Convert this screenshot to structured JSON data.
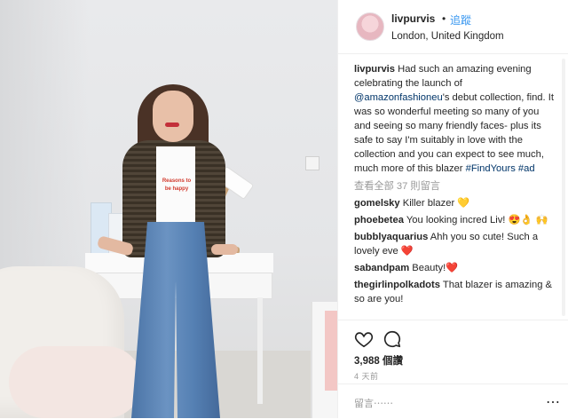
{
  "post": {
    "username": "livpurvis",
    "separator": "•",
    "follow_label": "追蹤",
    "location": "London, United Kingdom",
    "shirt_text": "Reasons to be happy"
  },
  "caption": {
    "username": "livpurvis",
    "part1": " Had such an amazing evening celebrating the launch of ",
    "mention": "@amazonfashioneu",
    "part2": "'s debut collection, find. It was so wonderful meeting so many of you and seeing so many friendly faces- plus its safe to say I'm suitably in love with the collection and you can expect to see much, much more of this blazer ",
    "tag1": "#FindYours",
    "space": " ",
    "tag2": "#ad"
  },
  "view_all": "查看全部 37 則留言",
  "comments": [
    {
      "user": "gomelsky",
      "text": " Killer blazer 💛"
    },
    {
      "user": "phoebetea",
      "text": " You looking incred Liv! 😍👌 🙌"
    },
    {
      "user": "bubblyaquarius",
      "text": " Ahh you so cute! Such a lovely eve ❤️"
    },
    {
      "user": "sabandpam",
      "text": " Beauty!❤️"
    },
    {
      "user": "thegirlinpolkadots",
      "text": " That blazer is amazing & so are you!"
    }
  ],
  "likes": "3,988 個讚",
  "time": "4 天前",
  "comment_placeholder": "留言⋯⋯",
  "more_label": "⋯",
  "icons": {
    "like": "heart-icon",
    "comment": "comment-icon",
    "more": "more-options-icon"
  },
  "colors": {
    "link": "#003569",
    "follow": "#3897f0",
    "muted": "#999999"
  }
}
